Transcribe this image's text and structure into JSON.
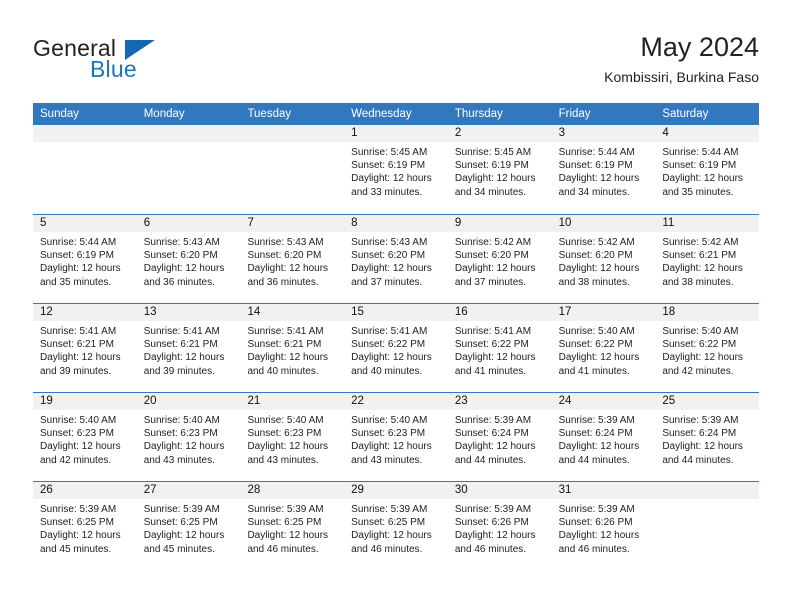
{
  "brand": {
    "name_top": "General",
    "name_bottom": "Blue",
    "triangle_color": "#1667b2",
    "blue_color": "#1b75bc"
  },
  "header": {
    "title": "May 2024",
    "subtitle": "Kombissiri, Burkina Faso"
  },
  "theme": {
    "header_bar": "#3178be",
    "day_number_band": "#f1f1f1",
    "week_divider": "#3178be",
    "text": "#222222"
  },
  "weekdays": [
    "Sunday",
    "Monday",
    "Tuesday",
    "Wednesday",
    "Thursday",
    "Friday",
    "Saturday"
  ],
  "weeks": [
    [
      {
        "day": "",
        "empty": true,
        "lines": []
      },
      {
        "day": "",
        "empty": true,
        "lines": []
      },
      {
        "day": "",
        "empty": true,
        "lines": []
      },
      {
        "day": "1",
        "lines": [
          "Sunrise: 5:45 AM",
          "Sunset: 6:19 PM",
          "Daylight: 12 hours",
          "and 33 minutes."
        ]
      },
      {
        "day": "2",
        "lines": [
          "Sunrise: 5:45 AM",
          "Sunset: 6:19 PM",
          "Daylight: 12 hours",
          "and 34 minutes."
        ]
      },
      {
        "day": "3",
        "lines": [
          "Sunrise: 5:44 AM",
          "Sunset: 6:19 PM",
          "Daylight: 12 hours",
          "and 34 minutes."
        ]
      },
      {
        "day": "4",
        "lines": [
          "Sunrise: 5:44 AM",
          "Sunset: 6:19 PM",
          "Daylight: 12 hours",
          "and 35 minutes."
        ]
      }
    ],
    [
      {
        "day": "5",
        "lines": [
          "Sunrise: 5:44 AM",
          "Sunset: 6:19 PM",
          "Daylight: 12 hours",
          "and 35 minutes."
        ]
      },
      {
        "day": "6",
        "lines": [
          "Sunrise: 5:43 AM",
          "Sunset: 6:20 PM",
          "Daylight: 12 hours",
          "and 36 minutes."
        ]
      },
      {
        "day": "7",
        "lines": [
          "Sunrise: 5:43 AM",
          "Sunset: 6:20 PM",
          "Daylight: 12 hours",
          "and 36 minutes."
        ]
      },
      {
        "day": "8",
        "lines": [
          "Sunrise: 5:43 AM",
          "Sunset: 6:20 PM",
          "Daylight: 12 hours",
          "and 37 minutes."
        ]
      },
      {
        "day": "9",
        "lines": [
          "Sunrise: 5:42 AM",
          "Sunset: 6:20 PM",
          "Daylight: 12 hours",
          "and 37 minutes."
        ]
      },
      {
        "day": "10",
        "lines": [
          "Sunrise: 5:42 AM",
          "Sunset: 6:20 PM",
          "Daylight: 12 hours",
          "and 38 minutes."
        ]
      },
      {
        "day": "11",
        "lines": [
          "Sunrise: 5:42 AM",
          "Sunset: 6:21 PM",
          "Daylight: 12 hours",
          "and 38 minutes."
        ]
      }
    ],
    [
      {
        "day": "12",
        "lines": [
          "Sunrise: 5:41 AM",
          "Sunset: 6:21 PM",
          "Daylight: 12 hours",
          "and 39 minutes."
        ]
      },
      {
        "day": "13",
        "lines": [
          "Sunrise: 5:41 AM",
          "Sunset: 6:21 PM",
          "Daylight: 12 hours",
          "and 39 minutes."
        ]
      },
      {
        "day": "14",
        "lines": [
          "Sunrise: 5:41 AM",
          "Sunset: 6:21 PM",
          "Daylight: 12 hours",
          "and 40 minutes."
        ]
      },
      {
        "day": "15",
        "lines": [
          "Sunrise: 5:41 AM",
          "Sunset: 6:22 PM",
          "Daylight: 12 hours",
          "and 40 minutes."
        ]
      },
      {
        "day": "16",
        "lines": [
          "Sunrise: 5:41 AM",
          "Sunset: 6:22 PM",
          "Daylight: 12 hours",
          "and 41 minutes."
        ]
      },
      {
        "day": "17",
        "lines": [
          "Sunrise: 5:40 AM",
          "Sunset: 6:22 PM",
          "Daylight: 12 hours",
          "and 41 minutes."
        ]
      },
      {
        "day": "18",
        "lines": [
          "Sunrise: 5:40 AM",
          "Sunset: 6:22 PM",
          "Daylight: 12 hours",
          "and 42 minutes."
        ]
      }
    ],
    [
      {
        "day": "19",
        "lines": [
          "Sunrise: 5:40 AM",
          "Sunset: 6:23 PM",
          "Daylight: 12 hours",
          "and 42 minutes."
        ]
      },
      {
        "day": "20",
        "lines": [
          "Sunrise: 5:40 AM",
          "Sunset: 6:23 PM",
          "Daylight: 12 hours",
          "and 43 minutes."
        ]
      },
      {
        "day": "21",
        "lines": [
          "Sunrise: 5:40 AM",
          "Sunset: 6:23 PM",
          "Daylight: 12 hours",
          "and 43 minutes."
        ]
      },
      {
        "day": "22",
        "lines": [
          "Sunrise: 5:40 AM",
          "Sunset: 6:23 PM",
          "Daylight: 12 hours",
          "and 43 minutes."
        ]
      },
      {
        "day": "23",
        "lines": [
          "Sunrise: 5:39 AM",
          "Sunset: 6:24 PM",
          "Daylight: 12 hours",
          "and 44 minutes."
        ]
      },
      {
        "day": "24",
        "lines": [
          "Sunrise: 5:39 AM",
          "Sunset: 6:24 PM",
          "Daylight: 12 hours",
          "and 44 minutes."
        ]
      },
      {
        "day": "25",
        "lines": [
          "Sunrise: 5:39 AM",
          "Sunset: 6:24 PM",
          "Daylight: 12 hours",
          "and 44 minutes."
        ]
      }
    ],
    [
      {
        "day": "26",
        "lines": [
          "Sunrise: 5:39 AM",
          "Sunset: 6:25 PM",
          "Daylight: 12 hours",
          "and 45 minutes."
        ]
      },
      {
        "day": "27",
        "lines": [
          "Sunrise: 5:39 AM",
          "Sunset: 6:25 PM",
          "Daylight: 12 hours",
          "and 45 minutes."
        ]
      },
      {
        "day": "28",
        "lines": [
          "Sunrise: 5:39 AM",
          "Sunset: 6:25 PM",
          "Daylight: 12 hours",
          "and 46 minutes."
        ]
      },
      {
        "day": "29",
        "lines": [
          "Sunrise: 5:39 AM",
          "Sunset: 6:25 PM",
          "Daylight: 12 hours",
          "and 46 minutes."
        ]
      },
      {
        "day": "30",
        "lines": [
          "Sunrise: 5:39 AM",
          "Sunset: 6:26 PM",
          "Daylight: 12 hours",
          "and 46 minutes."
        ]
      },
      {
        "day": "31",
        "lines": [
          "Sunrise: 5:39 AM",
          "Sunset: 6:26 PM",
          "Daylight: 12 hours",
          "and 46 minutes."
        ]
      },
      {
        "day": "",
        "empty": true,
        "lines": []
      }
    ]
  ]
}
